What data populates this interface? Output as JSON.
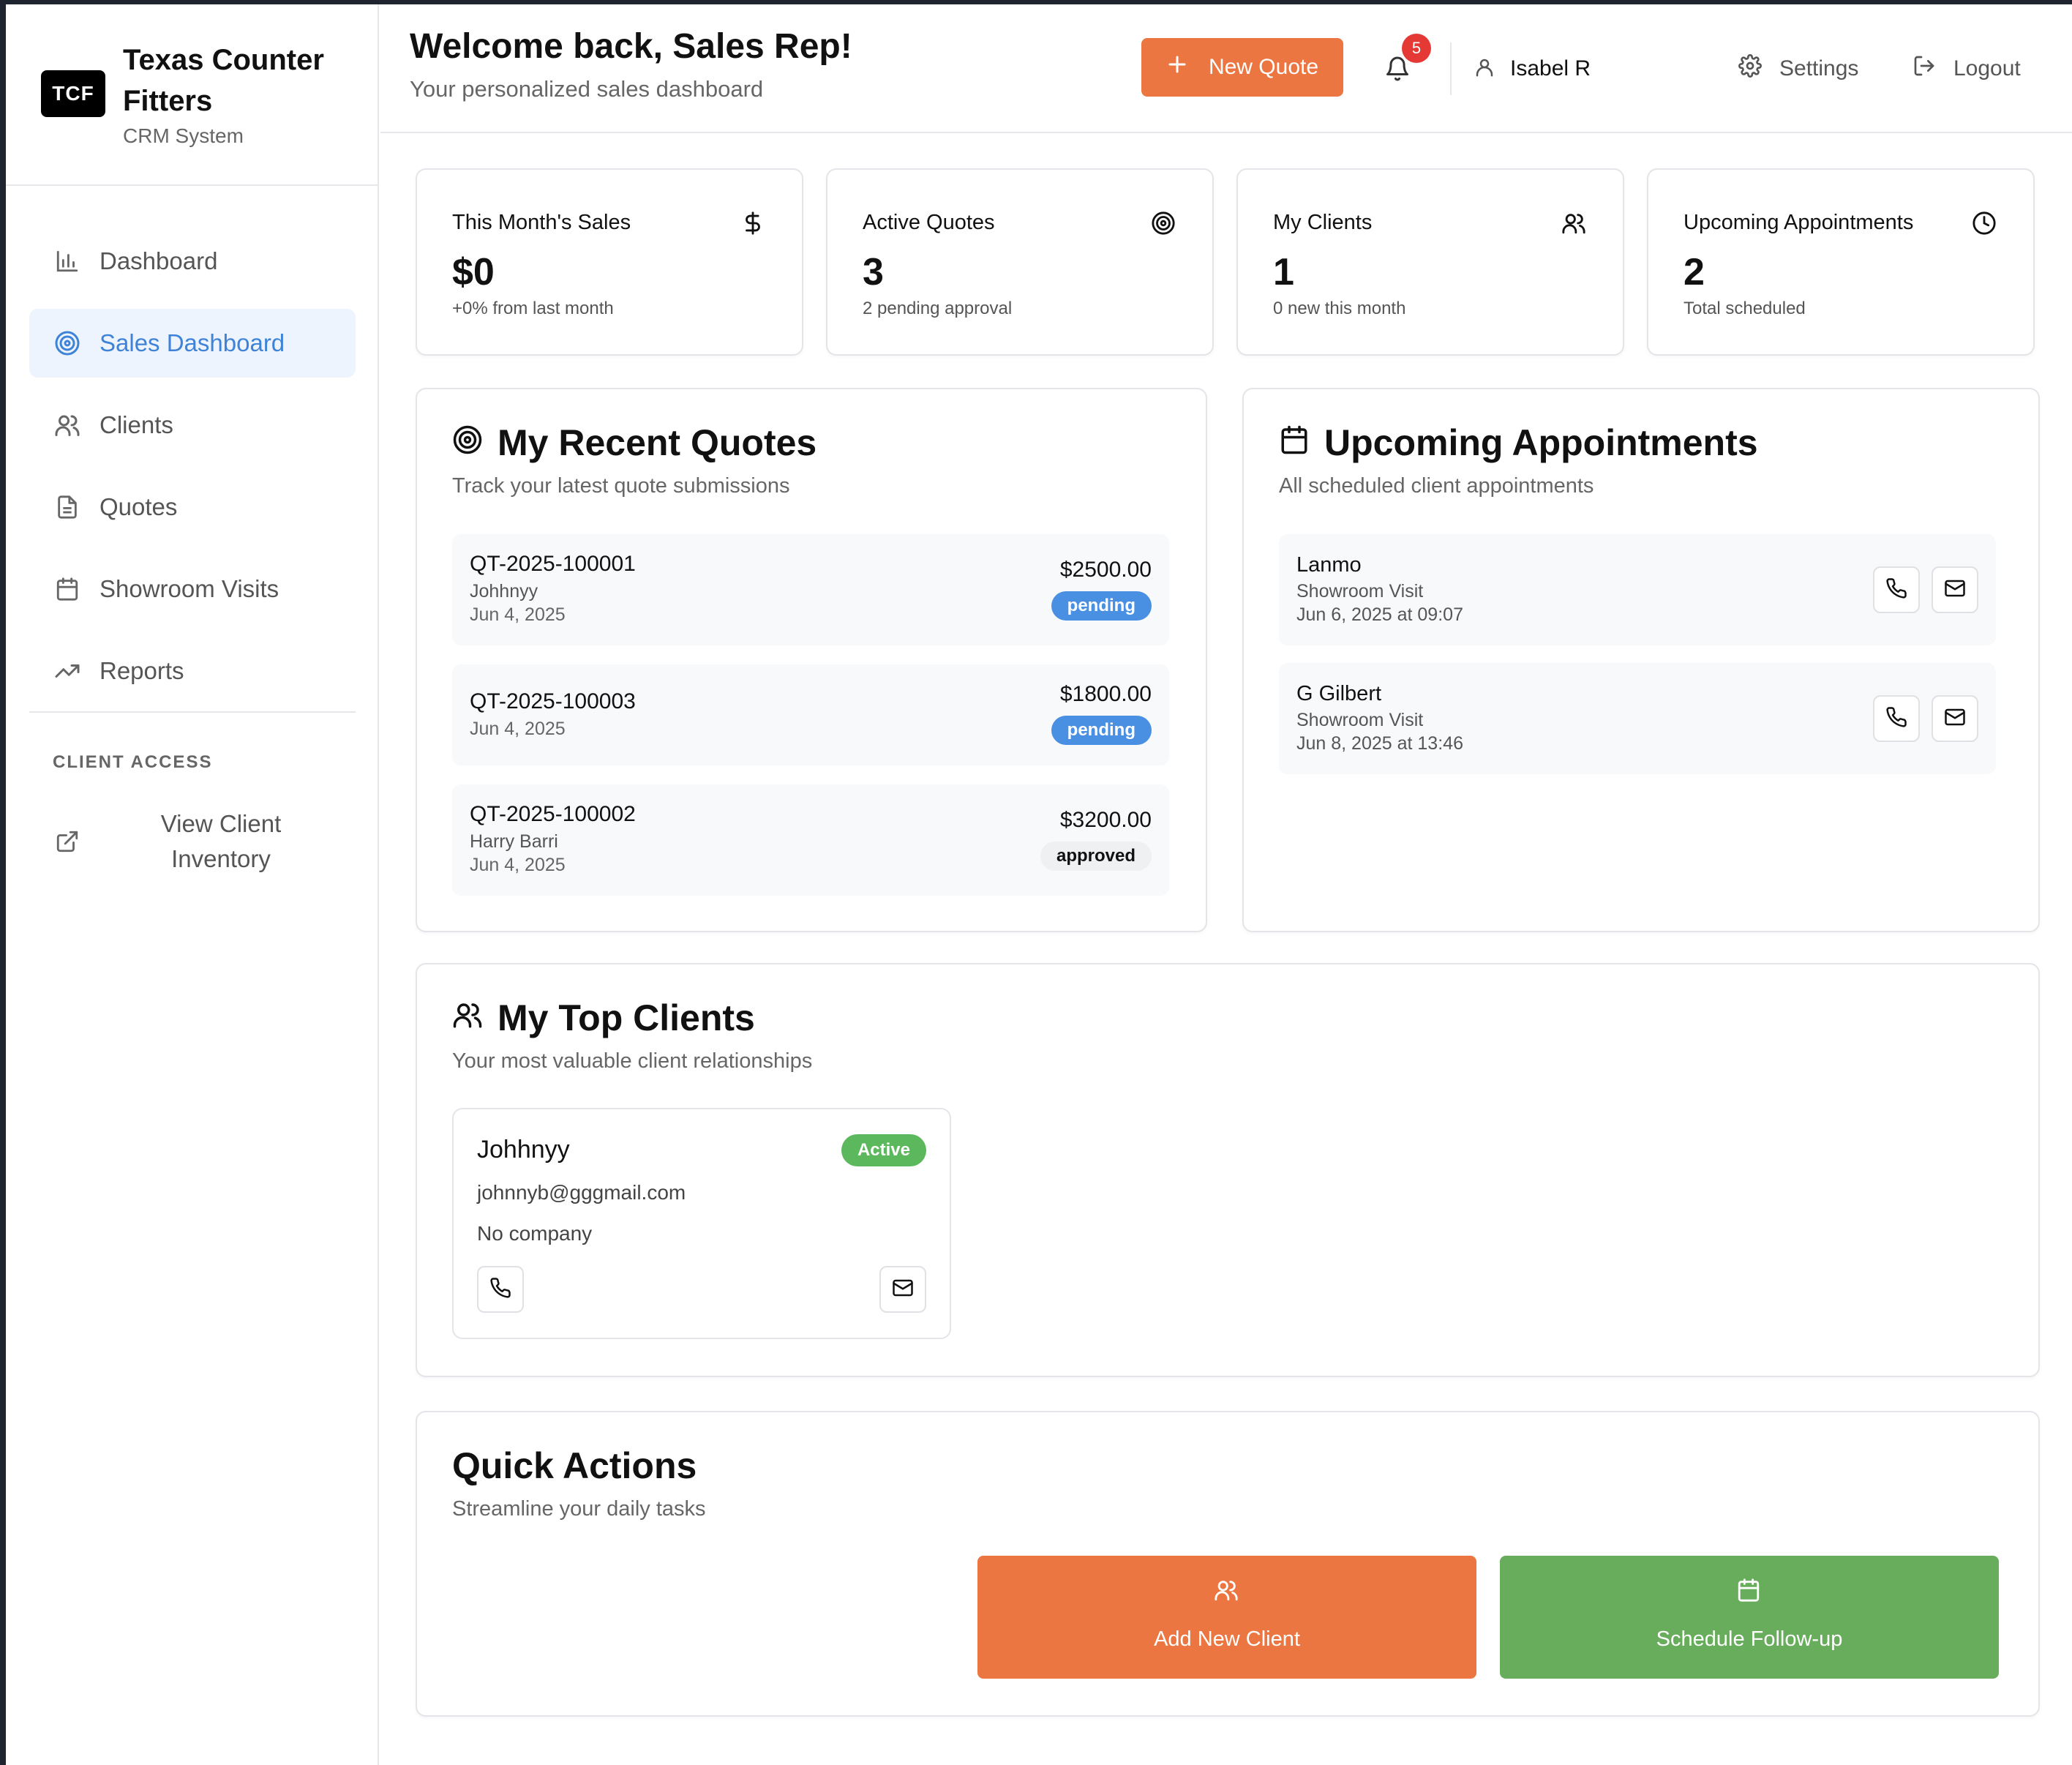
{
  "brand": {
    "logo_text": "TCF",
    "name": "Texas Counter Fitters",
    "subtitle": "CRM System"
  },
  "sidebar": {
    "items": [
      {
        "label": "Dashboard",
        "icon": "bar-chart-icon",
        "active": false
      },
      {
        "label": "Sales Dashboard",
        "icon": "target-icon",
        "active": true
      },
      {
        "label": "Clients",
        "icon": "users-icon",
        "active": false
      },
      {
        "label": "Quotes",
        "icon": "file-text-icon",
        "active": false
      },
      {
        "label": "Showroom Visits",
        "icon": "calendar-icon",
        "active": false
      },
      {
        "label": "Reports",
        "icon": "trending-up-icon",
        "active": false
      }
    ],
    "client_access_title": "CLIENT ACCESS",
    "view_inventory_label": "View Client Inventory"
  },
  "header": {
    "welcome": "Welcome back, Sales Rep!",
    "subtitle": "Your personalized sales dashboard",
    "new_quote_label": "New Quote",
    "notification_count": "5",
    "user_name": "Isabel R",
    "settings_label": "Settings",
    "logout_label": "Logout"
  },
  "stats": [
    {
      "title": "This Month's Sales",
      "value": "$0",
      "sub": "+0% from last month",
      "icon": "dollar-icon"
    },
    {
      "title": "Active Quotes",
      "value": "3",
      "sub": "2 pending approval",
      "icon": "target-icon"
    },
    {
      "title": "My Clients",
      "value": "1",
      "sub": "0 new this month",
      "icon": "users-icon"
    },
    {
      "title": "Upcoming Appointments",
      "value": "2",
      "sub": "Total scheduled",
      "icon": "clock-icon"
    }
  ],
  "recent_quotes": {
    "title": "My Recent Quotes",
    "subtitle": "Track your latest quote submissions",
    "items": [
      {
        "id": "QT-2025-100001",
        "client": "Johhnyy",
        "date": "Jun 4, 2025",
        "amount": "$2500.00",
        "status": "pending"
      },
      {
        "id": "QT-2025-100003",
        "client": "",
        "date": "Jun 4, 2025",
        "amount": "$1800.00",
        "status": "pending"
      },
      {
        "id": "QT-2025-100002",
        "client": "Harry Barri",
        "date": "Jun 4, 2025",
        "amount": "$3200.00",
        "status": "approved"
      }
    ]
  },
  "appointments": {
    "title": "Upcoming Appointments",
    "subtitle": "All scheduled client appointments",
    "items": [
      {
        "name": "Lanmo",
        "type": "Showroom Visit",
        "time": "Jun 6, 2025 at 09:07"
      },
      {
        "name": "G Gilbert",
        "type": "Showroom Visit",
        "time": "Jun 8, 2025 at 13:46"
      }
    ]
  },
  "top_clients": {
    "title": "My Top Clients",
    "subtitle": "Your most valuable client relationships",
    "client": {
      "name": "Johhnyy",
      "status": "Active",
      "email": "johnnyb@gggmail.com",
      "company": "No company"
    }
  },
  "quick_actions": {
    "title": "Quick Actions",
    "subtitle": "Streamline your daily tasks",
    "add_client_label": "Add New Client",
    "schedule_label": "Schedule Follow-up"
  },
  "colors": {
    "accent_orange": "#ec7641",
    "accent_green": "#68ad5b",
    "active_blue": "#3f83d8",
    "badge_blue": "#4a90e2",
    "status_green": "#5cb85c",
    "notification_red": "#e53935"
  }
}
